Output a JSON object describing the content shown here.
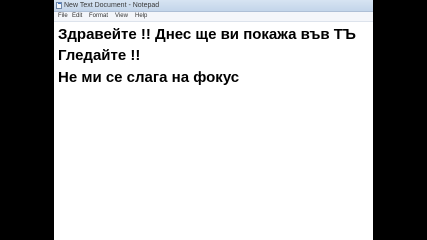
{
  "window": {
    "title": "New Text Document - Notepad"
  },
  "menu": {
    "items": [
      {
        "label": "File"
      },
      {
        "label": "Edit"
      },
      {
        "label": "Format"
      },
      {
        "label": "View"
      },
      {
        "label": "Help"
      }
    ]
  },
  "editor": {
    "lines": [
      "Здравейте !! Днес ще ви покажа във ТЪ",
      "Гледайте !!",
      "Не ми се слага на фокус"
    ]
  },
  "icons": {
    "app": "notepad-icon"
  },
  "colors": {
    "background": "#000000",
    "titlebar": "#c3d5ea",
    "editor_bg": "#ffffff",
    "text": "#000000"
  }
}
